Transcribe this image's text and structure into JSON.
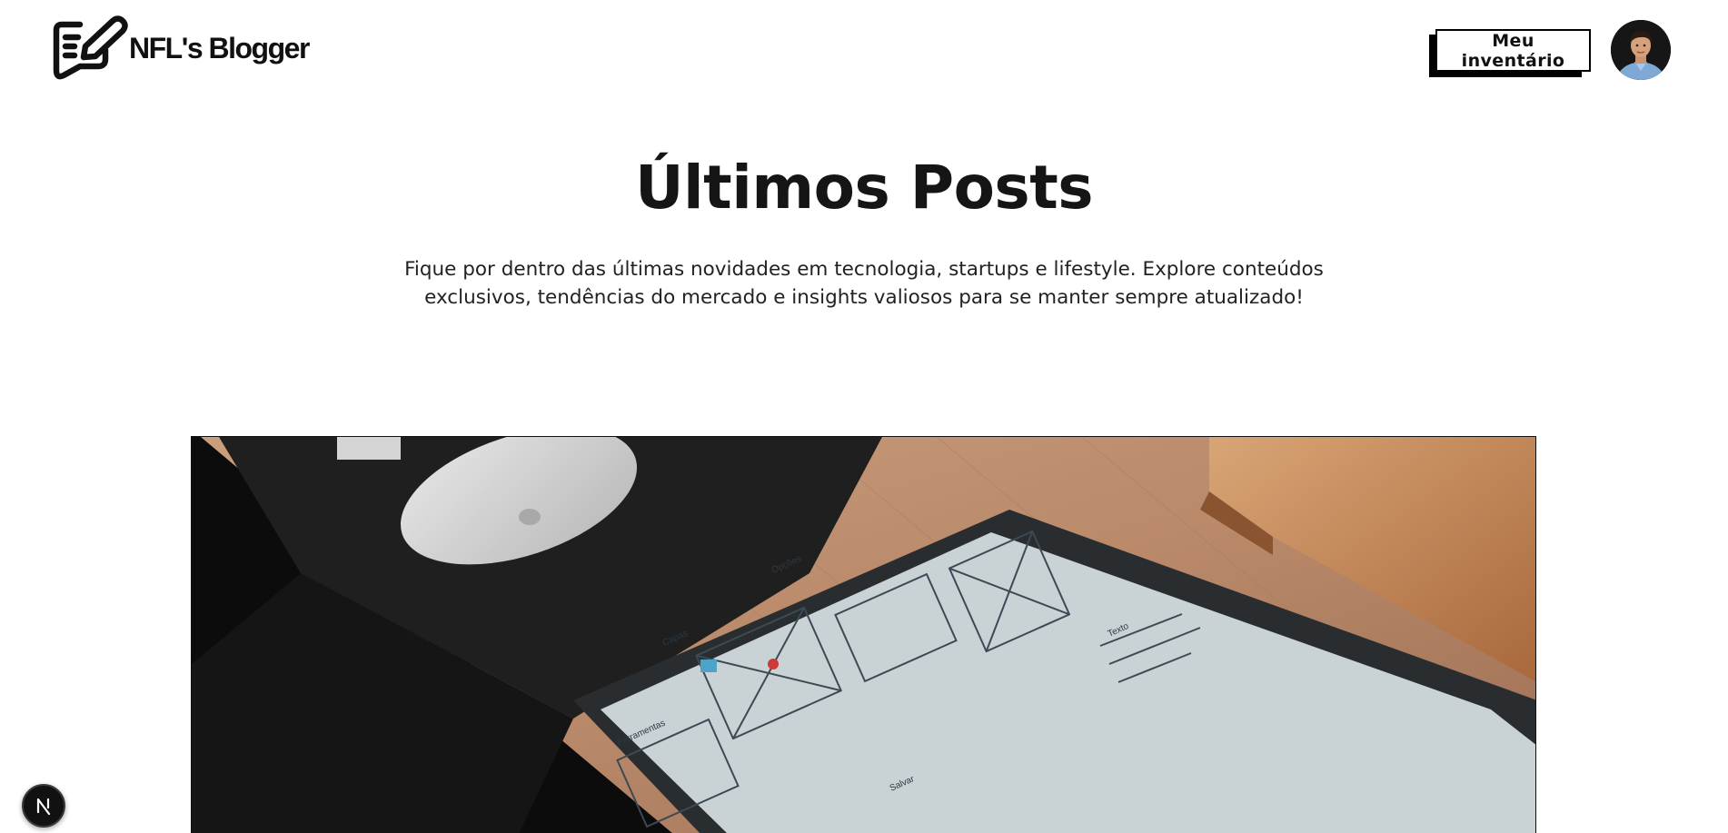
{
  "header": {
    "logo_text": "NFL's Blogger",
    "inventory_button_label": "Meu inventário"
  },
  "hero": {
    "title": "Últimos Posts",
    "subtitle": "Fique por dentro das últimas novidades em tecnologia, startups e lifestyle. Explore conteúdos exclusivos, tendências do mercado e insights valiosos para se manter sempre atualizado!"
  },
  "featured_post": {
    "image_text": [
      "Ferramentas",
      "Capas",
      "Opções",
      "Texto",
      "Salvar"
    ]
  },
  "dev_badge": {
    "letter": "N"
  },
  "colors": {
    "text": "#111111",
    "button_shadow": "#000000",
    "background": "#ffffff"
  },
  "icons": [
    "logo-pen-chat-icon",
    "avatar-photo",
    "nextjs-icon"
  ]
}
